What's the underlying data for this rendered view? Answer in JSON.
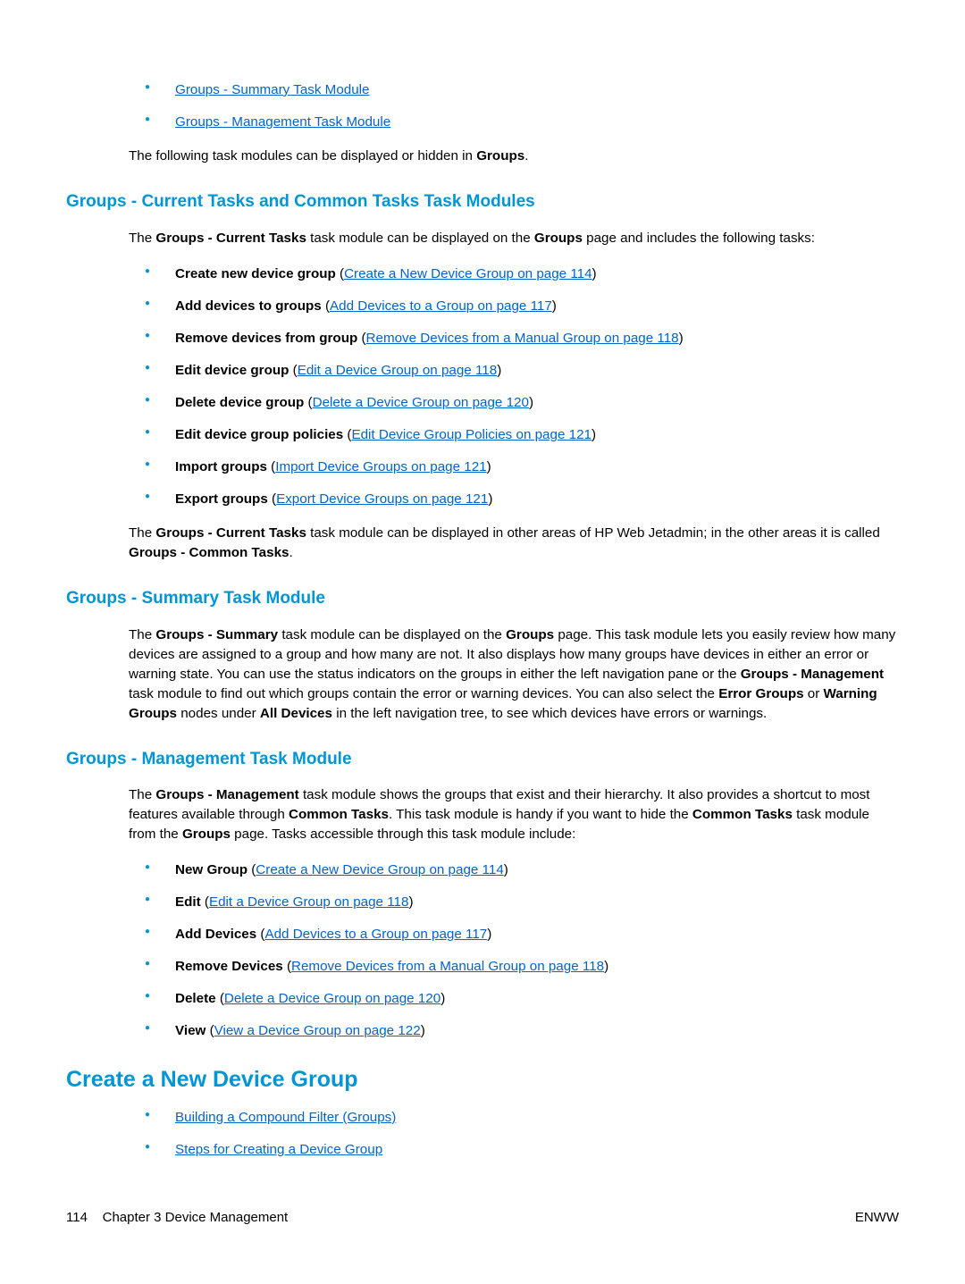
{
  "topLinks": {
    "summary": "Groups - Summary Task Module",
    "management": "Groups - Management Task Module"
  },
  "topPara": {
    "t1": "The following task modules can be displayed or hidden in ",
    "b1": "Groups",
    "t2": "."
  },
  "h2a": "Groups - Current Tasks and Common Tasks Task Modules",
  "p1": {
    "t1": "The ",
    "b1": "Groups - Current Tasks",
    "t2": " task module can be displayed on the ",
    "b2": "Groups",
    "t3": " page and includes the following tasks:"
  },
  "tasks": [
    {
      "bold": "Create new device group",
      "pre": " (",
      "link": "Create a New Device Group on page 114",
      "post": ")"
    },
    {
      "bold": "Add devices to groups",
      "pre": " (",
      "link": "Add Devices to a Group on page 117",
      "post": ")"
    },
    {
      "bold": "Remove devices from group",
      "pre": " (",
      "link": "Remove Devices from a Manual Group on page 118",
      "post": ")"
    },
    {
      "bold": "Edit device group",
      "pre": " (",
      "link": "Edit a Device Group on page 118",
      "post": ")"
    },
    {
      "bold": "Delete device group",
      "pre": " (",
      "link": "Delete a Device Group on page 120",
      "post": ")"
    },
    {
      "bold": "Edit device group policies",
      "pre": " (",
      "link": "Edit Device Group Policies on page 121",
      "post": ")"
    },
    {
      "bold": "Import groups",
      "pre": " (",
      "link": "Import Device Groups on page 121",
      "post": ")"
    },
    {
      "bold": "Export groups",
      "pre": " (",
      "link": "Export Device Groups on page 121",
      "post": ")"
    }
  ],
  "p2": {
    "t1": "The ",
    "b1": "Groups - Current Tasks",
    "t2": " task module can be displayed in other areas of HP Web Jetadmin; in the other areas it is called ",
    "b2": "Groups - Common Tasks",
    "t3": "."
  },
  "h2b": "Groups - Summary Task Module",
  "p3": {
    "t1": "The ",
    "b1": "Groups - Summary",
    "t2": " task module can be displayed on the ",
    "b2": "Groups",
    "t3": " page. This task module lets you easily review how many devices are assigned to a group and how many are not. It also displays how many groups have devices in either an error or warning state. You can use the status indicators on the groups in either the left navigation pane or the ",
    "b3": "Groups - Management",
    "t4": " task module to find out which groups contain the error or warning devices. You can also select the ",
    "b4": "Error Groups",
    "t5": " or ",
    "b5": "Warning Groups",
    "t6": " nodes under ",
    "b6": "All Devices",
    "t7": " in the left navigation tree, to see which devices have errors or warnings."
  },
  "h2c": "Groups - Management Task Module",
  "p4": {
    "t1": "The ",
    "b1": "Groups - Management",
    "t2": " task module shows the groups that exist and their hierarchy. It also provides a shortcut to most features available through ",
    "b2": "Common Tasks",
    "t3": ". This task module is handy if you want to hide the ",
    "b3": "Common Tasks",
    "t4": " task module from the ",
    "b4": "Groups",
    "t5": " page. Tasks accessible through this task module include:"
  },
  "mgmtTasks": [
    {
      "bold": "New Group",
      "pre": " (",
      "link": "Create a New Device Group on page 114",
      "post": ")"
    },
    {
      "bold": "Edit",
      "pre": " (",
      "link": "Edit a Device Group on page 118",
      "post": ")"
    },
    {
      "bold": "Add Devices",
      "pre": " (",
      "link": "Add Devices to a Group on page 117",
      "post": ")"
    },
    {
      "bold": "Remove Devices",
      "pre": " (",
      "link": "Remove Devices from a Manual Group on page 118",
      "post": ")"
    },
    {
      "bold": "Delete",
      "pre": " (",
      "link": "Delete a Device Group on page 120",
      "post": ")"
    },
    {
      "bold": "View",
      "pre": " (",
      "link": "View a Device Group on page 122",
      "post": ")"
    }
  ],
  "h1": "Create a New Device Group",
  "bottomLinks": {
    "building": "Building a Compound Filter (Groups)",
    "steps": "Steps for Creating a Device Group"
  },
  "footer": {
    "pageNum": "114",
    "chapter": "Chapter 3   Device Management",
    "right": "ENWW"
  }
}
